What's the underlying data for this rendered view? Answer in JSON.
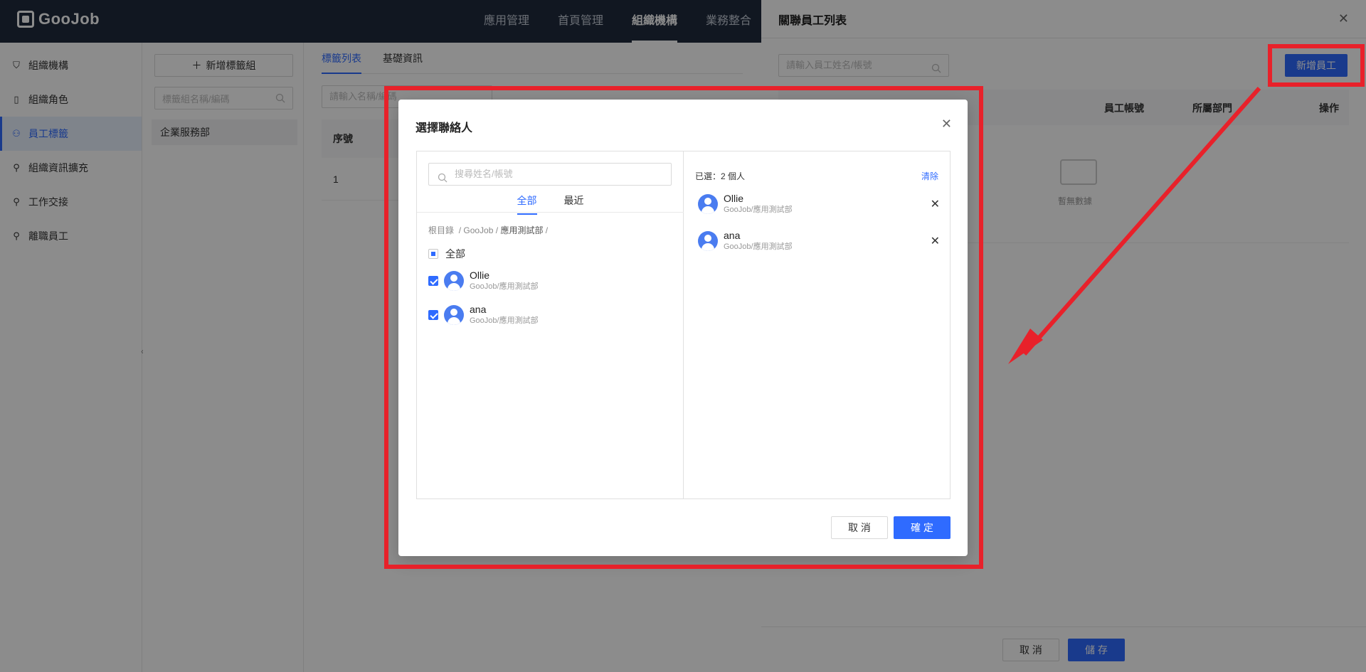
{
  "app": {
    "logo_text": "GooJob"
  },
  "topnav": {
    "items": [
      "應用管理",
      "首頁管理",
      "組織機構",
      "業務整合"
    ],
    "active": "組織機構"
  },
  "sidebar": {
    "items": [
      {
        "label": "組織機構",
        "icon": "org-icon"
      },
      {
        "label": "組織角色",
        "icon": "role-icon"
      },
      {
        "label": "員工標籤",
        "icon": "tag-icon"
      },
      {
        "label": "組織資訊擴充",
        "icon": "person-icon"
      },
      {
        "label": "工作交接",
        "icon": "handover-icon"
      },
      {
        "label": "離職員工",
        "icon": "person-icon"
      }
    ],
    "active": "員工標籤"
  },
  "tagpanel": {
    "add_label": "新增標籤組",
    "search_placeholder": "標籤組名稱/編碼",
    "items": [
      "企業服務部"
    ]
  },
  "main": {
    "tabs": [
      "標籤列表",
      "基礎資訊"
    ],
    "search_placeholder": "請輸入名稱/編碼",
    "col_index": "序號",
    "rows": [
      {
        "index": "1"
      }
    ]
  },
  "drawer": {
    "title": "關聯員工列表",
    "search_placeholder": "請輸入員工姓名/帳號",
    "add_button": "新增員工",
    "columns": [
      "員工帳號",
      "所屬部門",
      "操作"
    ],
    "empty_text": "暫無數據",
    "cancel": "取 消",
    "save": "儲 存"
  },
  "modal": {
    "title": "選擇聯絡人",
    "search_placeholder": "搜尋姓名/帳號",
    "tabs": [
      "全部",
      "最近"
    ],
    "breadcrumb": {
      "root": "根目錄",
      "sep": "/",
      "org": "GooJob",
      "dept": "應用測試部"
    },
    "check_all": "全部",
    "people": [
      {
        "name": "Ollie",
        "dept": "GooJob/應用測試部",
        "checked": true
      },
      {
        "name": "ana",
        "dept": "GooJob/應用測試部",
        "checked": true
      }
    ],
    "selected_label": "已選：2 個人",
    "clear": "清除",
    "selected": [
      {
        "name": "Ollie",
        "dept": "GooJob/應用測試部"
      },
      {
        "name": "ana",
        "dept": "GooJob/應用測試部"
      }
    ],
    "cancel": "取 消",
    "ok": "確 定"
  },
  "colors": {
    "primary": "#2f6bff",
    "annotation": "#e8212a",
    "topbar": "#1f2a3d"
  }
}
